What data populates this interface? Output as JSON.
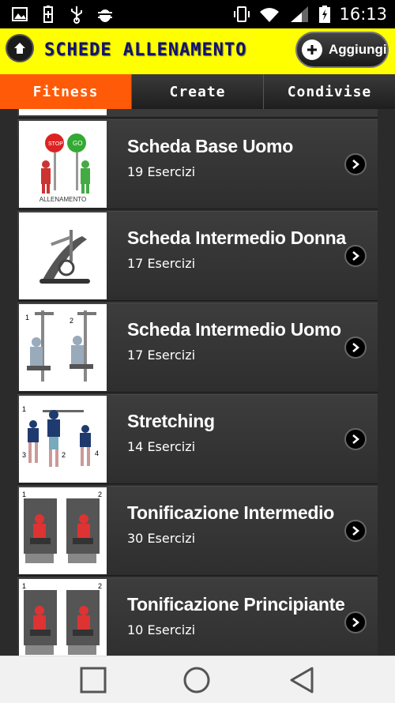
{
  "status_bar": {
    "time": "16:13",
    "left_icons": [
      "image-icon",
      "battery-saver-icon",
      "usb-icon",
      "android-debug-icon"
    ],
    "right_icons": [
      "vibrate-icon",
      "wifi-icon",
      "signal-icon",
      "battery-charging-icon"
    ]
  },
  "header": {
    "title": "SCHEDE ALLENAMENTO",
    "add_label": "Aggiungi"
  },
  "tabs": [
    {
      "label": "Fitness",
      "active": true
    },
    {
      "label": "Create",
      "active": false
    },
    {
      "label": "Condivise",
      "active": false
    }
  ],
  "workouts": [
    {
      "title": "Scheda Base Uomo",
      "count": "19 Esercizi",
      "thumb_caption": "ALLENAMENTO"
    },
    {
      "title": "Scheda Intermedio Donna",
      "count": "17 Esercizi"
    },
    {
      "title": "Scheda Intermedio Uomo",
      "count": "17 Esercizi"
    },
    {
      "title": "Stretching",
      "count": "14 Esercizi"
    },
    {
      "title": "Tonificazione Intermedio",
      "count": "30 Esercizi"
    },
    {
      "title": "Tonificazione Principiante",
      "count": "10 Esercizi"
    }
  ],
  "colors": {
    "header_bg": "#ffff00",
    "title_color": "#11117a",
    "active_tab": "#ff5a08",
    "list_bg": "#3a3a3a"
  }
}
